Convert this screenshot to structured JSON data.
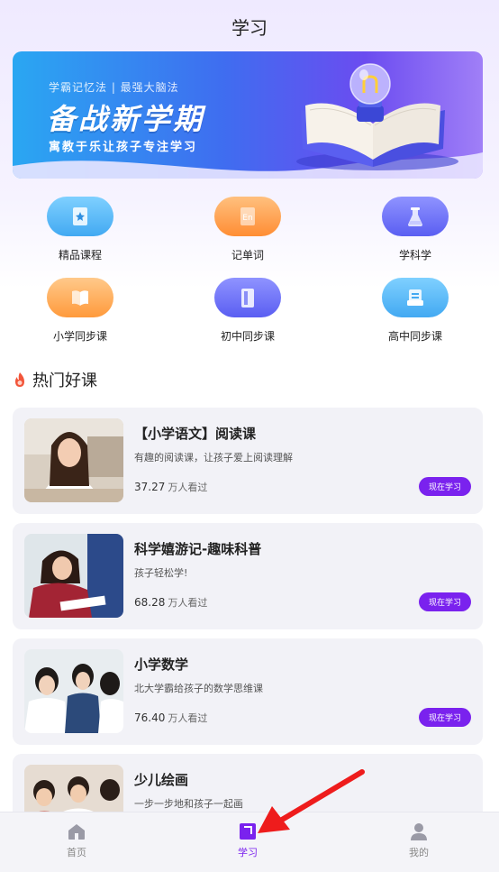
{
  "header": {
    "title": "学习"
  },
  "banner": {
    "tag": "学霸记忆法 | 最强大脑法",
    "headline": "备战新学期",
    "sub": "寓教于乐让孩子专注学习"
  },
  "grid": [
    {
      "label": "精品课程",
      "icon": "star-book-icon",
      "color": "#4fb8f5"
    },
    {
      "label": "记单词",
      "icon": "en-book-icon",
      "color": "#ff9d4a"
    },
    {
      "label": "学科学",
      "icon": "flask-icon",
      "color": "#6a6cf6"
    },
    {
      "label": "小学同步课",
      "icon": "open-book-icon",
      "color": "#ffac4e"
    },
    {
      "label": "初中同步课",
      "icon": "phone-book-icon",
      "color": "#6a6cf6"
    },
    {
      "label": "高中同步课",
      "icon": "document-icon",
      "color": "#4fb8f5"
    }
  ],
  "section": {
    "title": "热门好课",
    "icon": "fire-icon"
  },
  "courses": [
    {
      "title": "【小学语文】阅读课",
      "desc": "有趣的阅读课，让孩子爱上阅读理解",
      "views": "37.27",
      "unit": "万人看过",
      "button": "现在学习"
    },
    {
      "title": "科学嬉游记-趣味科普",
      "desc": "孩子轻松学!",
      "views": "68.28",
      "unit": "万人看过",
      "button": "现在学习"
    },
    {
      "title": "小学数学",
      "desc": "北大学霸给孩子的数学思维课",
      "views": "76.40",
      "unit": "万人看过",
      "button": "现在学习"
    },
    {
      "title": "少儿绘画",
      "desc": "一步一步地和孩子一起画",
      "views": "",
      "unit": "",
      "button": ""
    }
  ],
  "tabbar": {
    "items": [
      {
        "label": "首页",
        "icon": "home-icon",
        "active": false
      },
      {
        "label": "学习",
        "icon": "study-icon",
        "active": true
      },
      {
        "label": "我的",
        "icon": "profile-icon",
        "active": false
      }
    ],
    "active_color": "#7a22ee"
  }
}
